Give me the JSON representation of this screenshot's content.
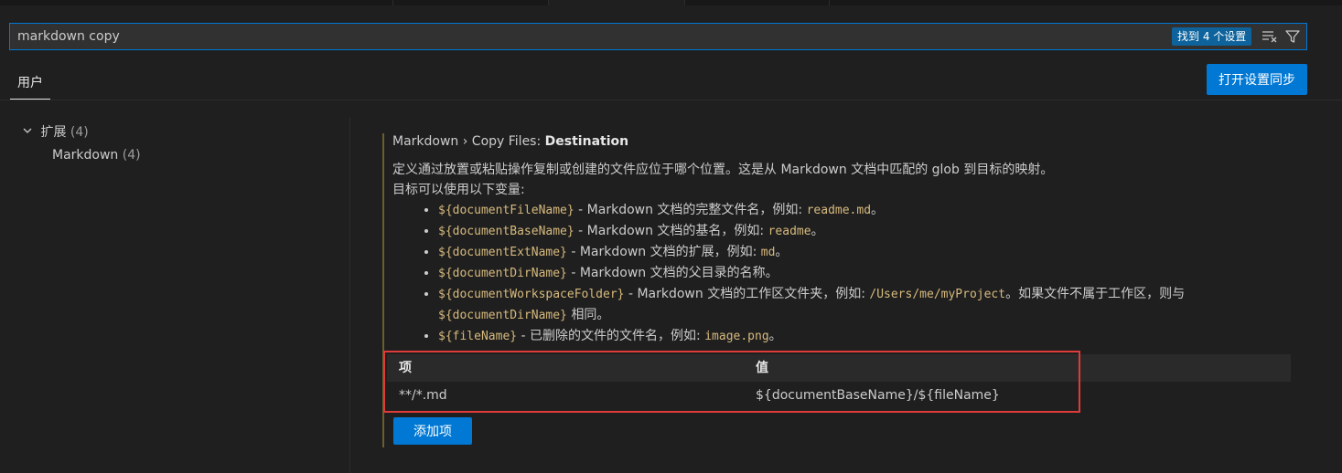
{
  "search": {
    "value": "markdown copy",
    "results": "找到 4 个设置"
  },
  "icons": {
    "clear": "clear-filter-icon",
    "filter": "filter-icon",
    "expand": "chevron-down-icon"
  },
  "tabs": {
    "user": "用户",
    "sync_button": "打开设置同步"
  },
  "toc": {
    "extensions": {
      "label": "扩展",
      "count": "(4)"
    },
    "markdown": {
      "label": "Markdown",
      "count": "(4)"
    }
  },
  "setting": {
    "title_prefix": "Markdown › Copy Files: ",
    "title_name": "Destination",
    "desc_line1": "定义通过放置或粘贴操作复制或创建的文件应位于哪个位置。这是从 Markdown 文档中匹配的 glob 到目标的映射。",
    "desc_line2": "目标可以使用以下变量:",
    "vars": [
      {
        "var": "${documentFileName}",
        "text": " - Markdown 文档的完整文件名，例如: ",
        "example": "readme.md",
        "tail": "。"
      },
      {
        "var": "${documentBaseName}",
        "text": " - Markdown 文档的基名，例如: ",
        "example": "readme",
        "tail": "。"
      },
      {
        "var": "${documentExtName}",
        "text": " - Markdown 文档的扩展，例如: ",
        "example": "md",
        "tail": "。"
      },
      {
        "var": "${documentDirName}",
        "text": " - Markdown 文档的父目录的名称。"
      },
      {
        "var": "${documentWorkspaceFolder}",
        "text": " - Markdown 文档的工作区文件夹，例如: ",
        "example": "/Users/me/myProject",
        "tail": "。如果文件不属于工作区，则与 ",
        "var2": "${documentDirName}",
        "tail2": " 相同。"
      },
      {
        "var": "${fileName}",
        "text": " - 已删除的文件的文件名，例如: ",
        "example": "image.png",
        "tail": "。"
      }
    ]
  },
  "table": {
    "header_key": "项",
    "header_value": "值",
    "rows": [
      {
        "key": "**/*.md",
        "value": "${documentBaseName}/${fileName}"
      }
    ]
  },
  "add_button": "添加项",
  "colors": {
    "accent": "#0078d4",
    "highlight": "#e03b3b",
    "code": "#d7ba7d"
  }
}
